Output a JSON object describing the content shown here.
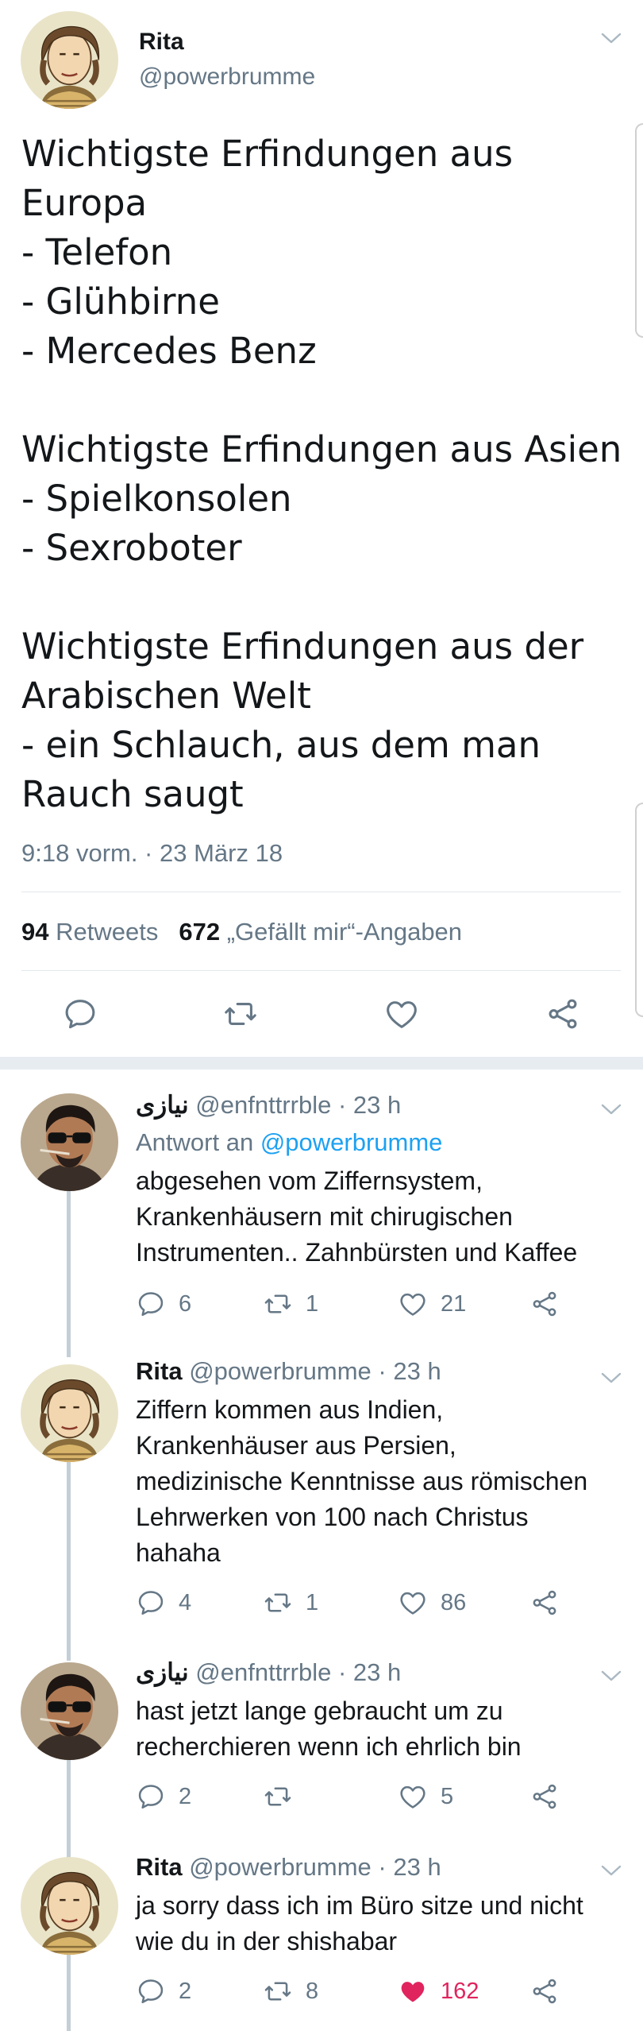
{
  "main_tweet": {
    "name": "Rita",
    "handle": "@powerbrumme",
    "text_lines": [
      "Wichtigste Erfindungen aus",
      "Europa",
      "- Telefon",
      "- Glühbirne",
      "- Mercedes Benz",
      "",
      "Wichtigste Erfindungen aus Asien",
      "- Spielkonsolen",
      "- Sexroboter",
      "",
      "Wichtigste Erfindungen aus der",
      "Arabischen Welt",
      "- ein Schlauch, aus dem man",
      "Rauch saugt"
    ],
    "timestamp": "9:18 vorm. · 23 März 18",
    "retweet_count": "94",
    "retweet_label": "Retweets",
    "like_count": "672",
    "like_label": "„Gefällt mir“-Angaben"
  },
  "replies": [
    {
      "name": "نیازی",
      "handle": "@enfnttrrble",
      "time": "· 23 h",
      "replying_prefix": "Antwort an",
      "replying_to": "@powerbrumme",
      "lines": [
        "abgesehen vom Ziffernsystem,",
        "Krankenhäusern mit chirugischen",
        "Instrumenten.. Zahnbürsten und Kaffee"
      ],
      "replies": "6",
      "retweets": "1",
      "likes": "21"
    },
    {
      "name": "Rita",
      "handle": "@powerbrumme",
      "time": "· 23 h",
      "lines": [
        "Ziffern kommen aus Indien,",
        "Krankenhäuser aus Persien,",
        "medizinische Kenntnisse aus römischen",
        "Lehrwerken von 100 nach Christus",
        "hahaha"
      ],
      "replies": "4",
      "retweets": "1",
      "likes": "86"
    },
    {
      "name": "نیازی",
      "handle": "@enfnttrrble",
      "time": "· 23 h",
      "lines": [
        "hast jetzt lange gebraucht um zu",
        "recherchieren wenn ich ehrlich bin"
      ],
      "replies": "2",
      "retweets": "",
      "likes": "5"
    },
    {
      "name": "Rita",
      "handle": "@powerbrumme",
      "time": "· 23 h",
      "lines": [
        "ja sorry dass ich im Büro sitze und nicht",
        "wie du in der shishabar"
      ],
      "replies": "2",
      "retweets": "8",
      "likes": "162",
      "liked": true
    }
  ],
  "colors": {
    "text": "#14171a",
    "secondary": "#657786",
    "link": "#1da1f2",
    "like_active": "#e0245e",
    "separator": "#e6ecf0",
    "thread_line": "#c4cfd6"
  },
  "icons": {
    "reply": "reply-icon",
    "retweet": "retweet-icon",
    "like": "heart-icon",
    "share": "share-icon",
    "menu": "chevron-down-icon"
  }
}
